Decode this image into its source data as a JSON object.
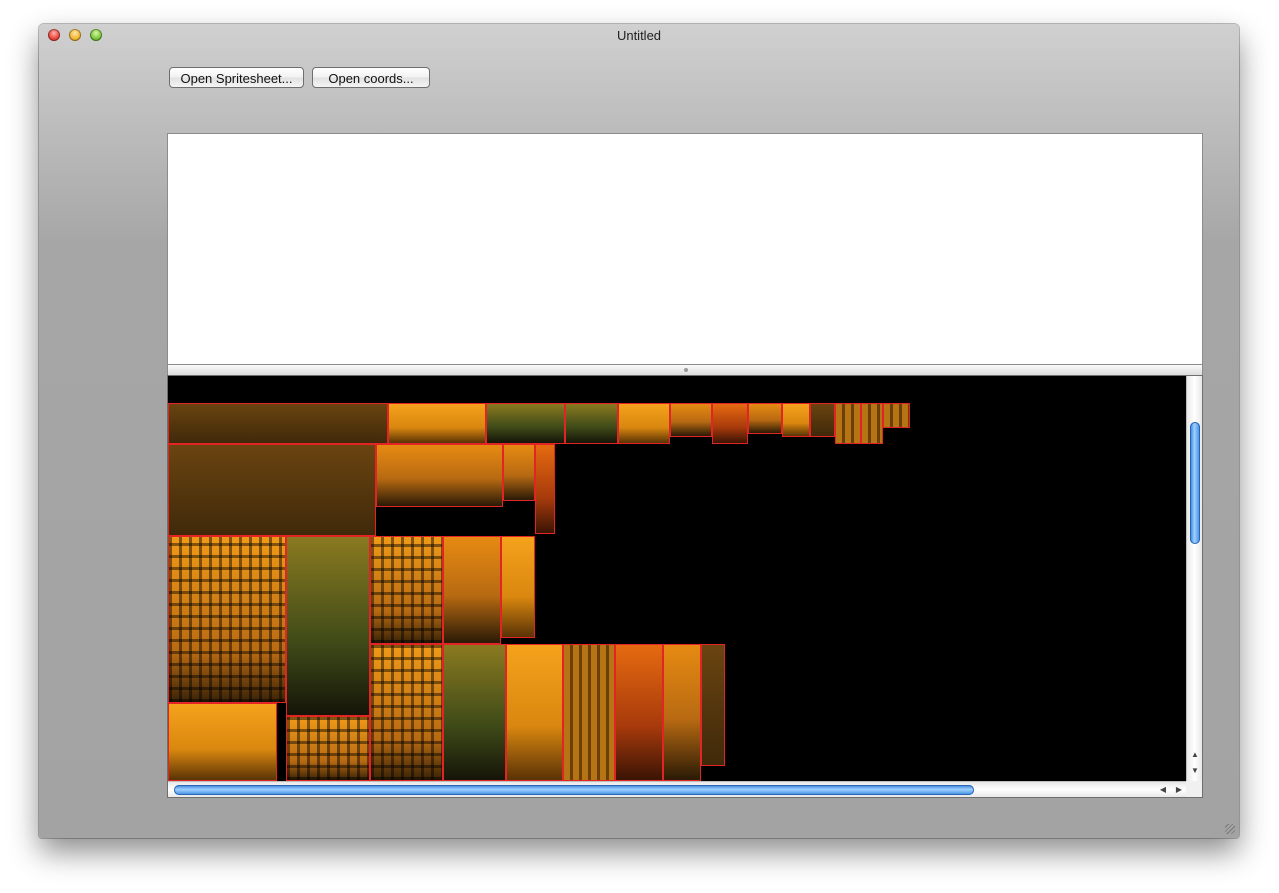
{
  "window": {
    "title": "Untitled"
  },
  "toolbar": {
    "open_spritesheet_label": "Open Spritesheet...",
    "open_coords_label": "Open coords..."
  },
  "icons": {
    "close": "close-icon",
    "minimize": "minimize-icon",
    "zoom": "zoom-icon",
    "scroll_up": "chevron-up-icon",
    "scroll_down": "chevron-down-icon",
    "scroll_left": "chevron-left-icon",
    "scroll_right": "chevron-right-icon",
    "resize_grip": "resize-grip-icon"
  },
  "colors": {
    "sprite_outline": "#e32424",
    "canvas_background": "#000000",
    "scroll_thumb": "#3b8ae0"
  }
}
